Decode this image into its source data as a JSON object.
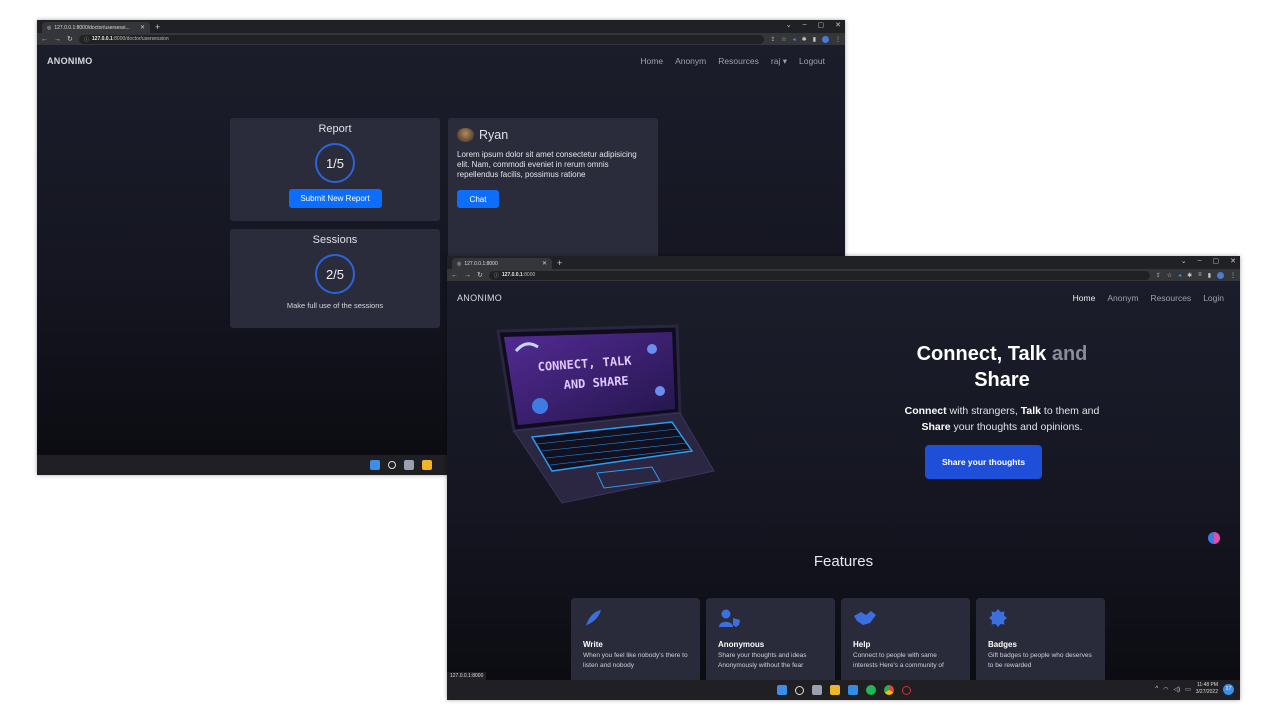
{
  "window_back": {
    "tab_title": "127.0.0.1:8000/doctor/usersessi...",
    "url_host": "127.0.0.1",
    "url_path": ":8000/doctor/usersession",
    "brand": "ANONIMO",
    "nav": {
      "home": "Home",
      "anonym": "Anonym",
      "resources": "Resources",
      "user": "raj",
      "logout": "Logout"
    },
    "report": {
      "title": "Report",
      "progress_text": "1/5",
      "progress": 0.2,
      "button": "Submit New Report"
    },
    "sessions": {
      "title": "Sessions",
      "progress_text": "2/5",
      "progress": 0.4,
      "note": "Make full use of the sessions"
    },
    "doctor": {
      "name": "Ryan",
      "bio": "Lorem ipsum dolor sit amet consectetur adipisicing elit. Nam, commodi eveniet in rerum omnis repellendus facilis, possimus ratione",
      "chat_button": "Chat"
    }
  },
  "window_front": {
    "tab_title": "127.0.0.1:8000",
    "url_host": "127.0.0.1",
    "url_path": ":8000",
    "brand": "ANONIMO",
    "nav": {
      "home": "Home",
      "anonym": "Anonym",
      "resources": "Resources",
      "login": "Login"
    },
    "hero": {
      "title_1": "Connect, Talk",
      "title_2": "and",
      "title_3": "Share",
      "sub_b1": "Connect",
      "sub_t1": " with strangers, ",
      "sub_b2": "Talk",
      "sub_t2": " to them and",
      "sub_b3": "Share",
      "sub_t3": " your thoughts and opinions.",
      "button": "Share your thoughts",
      "laptop_text_1": "CONNECT, TALK",
      "laptop_text_2": "AND SHARE"
    },
    "features_title": "Features",
    "features": [
      {
        "title": "Write",
        "desc": "When you feel like nobody's there to listen and nobody",
        "icon": "feather-icon"
      },
      {
        "title": "Anonymous",
        "desc": "Share your thoughts and ideas Anonymously without the fear",
        "icon": "user-shield-icon"
      },
      {
        "title": "Help",
        "desc": "Connect to people with same interests Here's a community of",
        "icon": "handshake-icon"
      },
      {
        "title": "Badges",
        "desc": "Gift badges to people who deserves to be rewarded",
        "icon": "badge-icon"
      }
    ],
    "status_url": "127.0.0.1:8000",
    "tray": {
      "time": "11:48 PM",
      "date": "3/27/2022",
      "badge": "17"
    }
  },
  "colors": {
    "accent": "#0d6efd",
    "hero_button": "#1f4fd8",
    "ring": "#2b63d9",
    "card": "#2b2c3b"
  }
}
